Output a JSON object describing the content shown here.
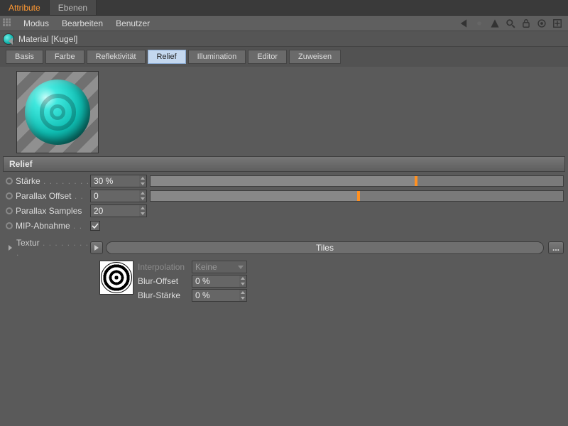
{
  "top_tabs": {
    "attribute": "Attribute",
    "ebenen": "Ebenen"
  },
  "menu": {
    "modus": "Modus",
    "bearbeiten": "Bearbeiten",
    "benutzer": "Benutzer"
  },
  "object": {
    "title": "Material [Kugel]"
  },
  "channels": {
    "basis": "Basis",
    "farbe": "Farbe",
    "reflektivitaet": "Reflektivität",
    "relief": "Relief",
    "illumination": "Illumination",
    "editor": "Editor",
    "zuweisen": "Zuweisen"
  },
  "section": {
    "relief": "Relief"
  },
  "params": {
    "staerke": {
      "label": "Stärke",
      "value": "30 %",
      "fill": 64,
      "mark": 64
    },
    "parallax_offset": {
      "label": "Parallax Offset",
      "value": "0",
      "fill": 50,
      "mark": 50
    },
    "parallax_samples": {
      "label": "Parallax Samples",
      "value": "20"
    },
    "mip": {
      "label": "MIP-Abnahme",
      "checked": true
    },
    "textur": {
      "label": "Textur",
      "value": "Tiles",
      "browse": "..."
    },
    "interpolation": {
      "label": "Interpolation",
      "value": "Keine"
    },
    "blur_offset": {
      "label": "Blur-Offset",
      "value": "0 %"
    },
    "blur_staerke": {
      "label": "Blur-Stärke",
      "value": "0 %"
    }
  },
  "tool_icons": {
    "prev": "prev-icon",
    "toggle": "toggle-icon",
    "up": "up-arrow-icon",
    "search": "search-icon",
    "lock": "lock-icon",
    "target": "target-icon",
    "new": "new-panel-icon"
  }
}
